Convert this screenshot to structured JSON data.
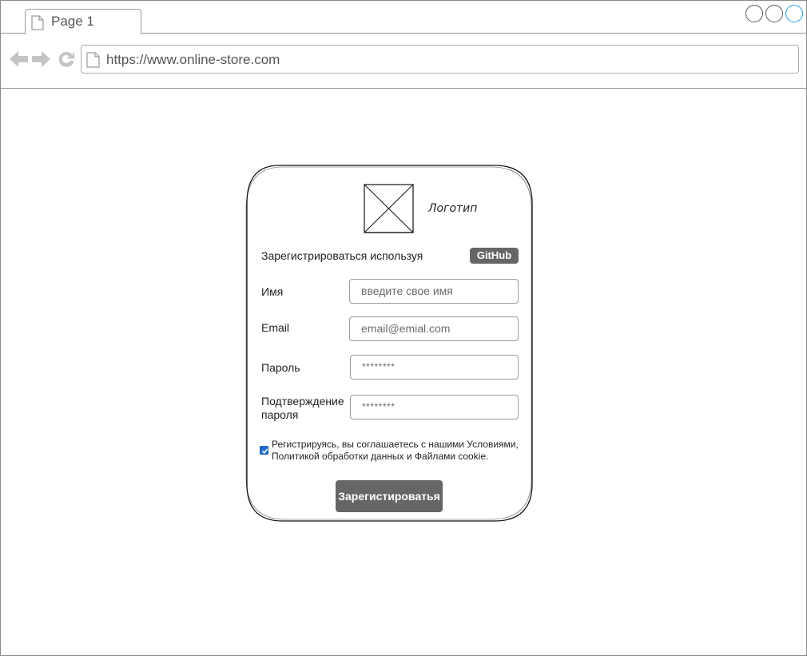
{
  "browser": {
    "tab_label": "Page 1",
    "url": "https://www.online-store.com",
    "window_controls": [
      "minimize-icon",
      "maximize-icon",
      "close-icon"
    ],
    "nav_icons": [
      "back-arrow-icon",
      "forward-arrow-icon",
      "reload-icon"
    ]
  },
  "card": {
    "logo_label": "Логотип",
    "signup_with_label": "Зарегистрироваться используя",
    "github_button": "GitHub",
    "fields": [
      {
        "label": "Имя",
        "placeholder": "введите свое имя"
      },
      {
        "label": "Email",
        "placeholder": "email@emial.com"
      },
      {
        "label": "Пароль",
        "placeholder": "********"
      },
      {
        "label": "Подтверждение пароля",
        "placeholder": "********"
      }
    ],
    "agree_checked": true,
    "agree_text": "Регистрируясь, вы соглашаетесь с нашими Условиями, Политикой обработки данных и Файлами cookie.",
    "submit_button": "Зарегистироватья"
  },
  "colors": {
    "button_bg": "#666666",
    "button_text": "#ffffff",
    "active_window_control": "#1ba1e2",
    "checkbox": "#1f6fd1"
  }
}
